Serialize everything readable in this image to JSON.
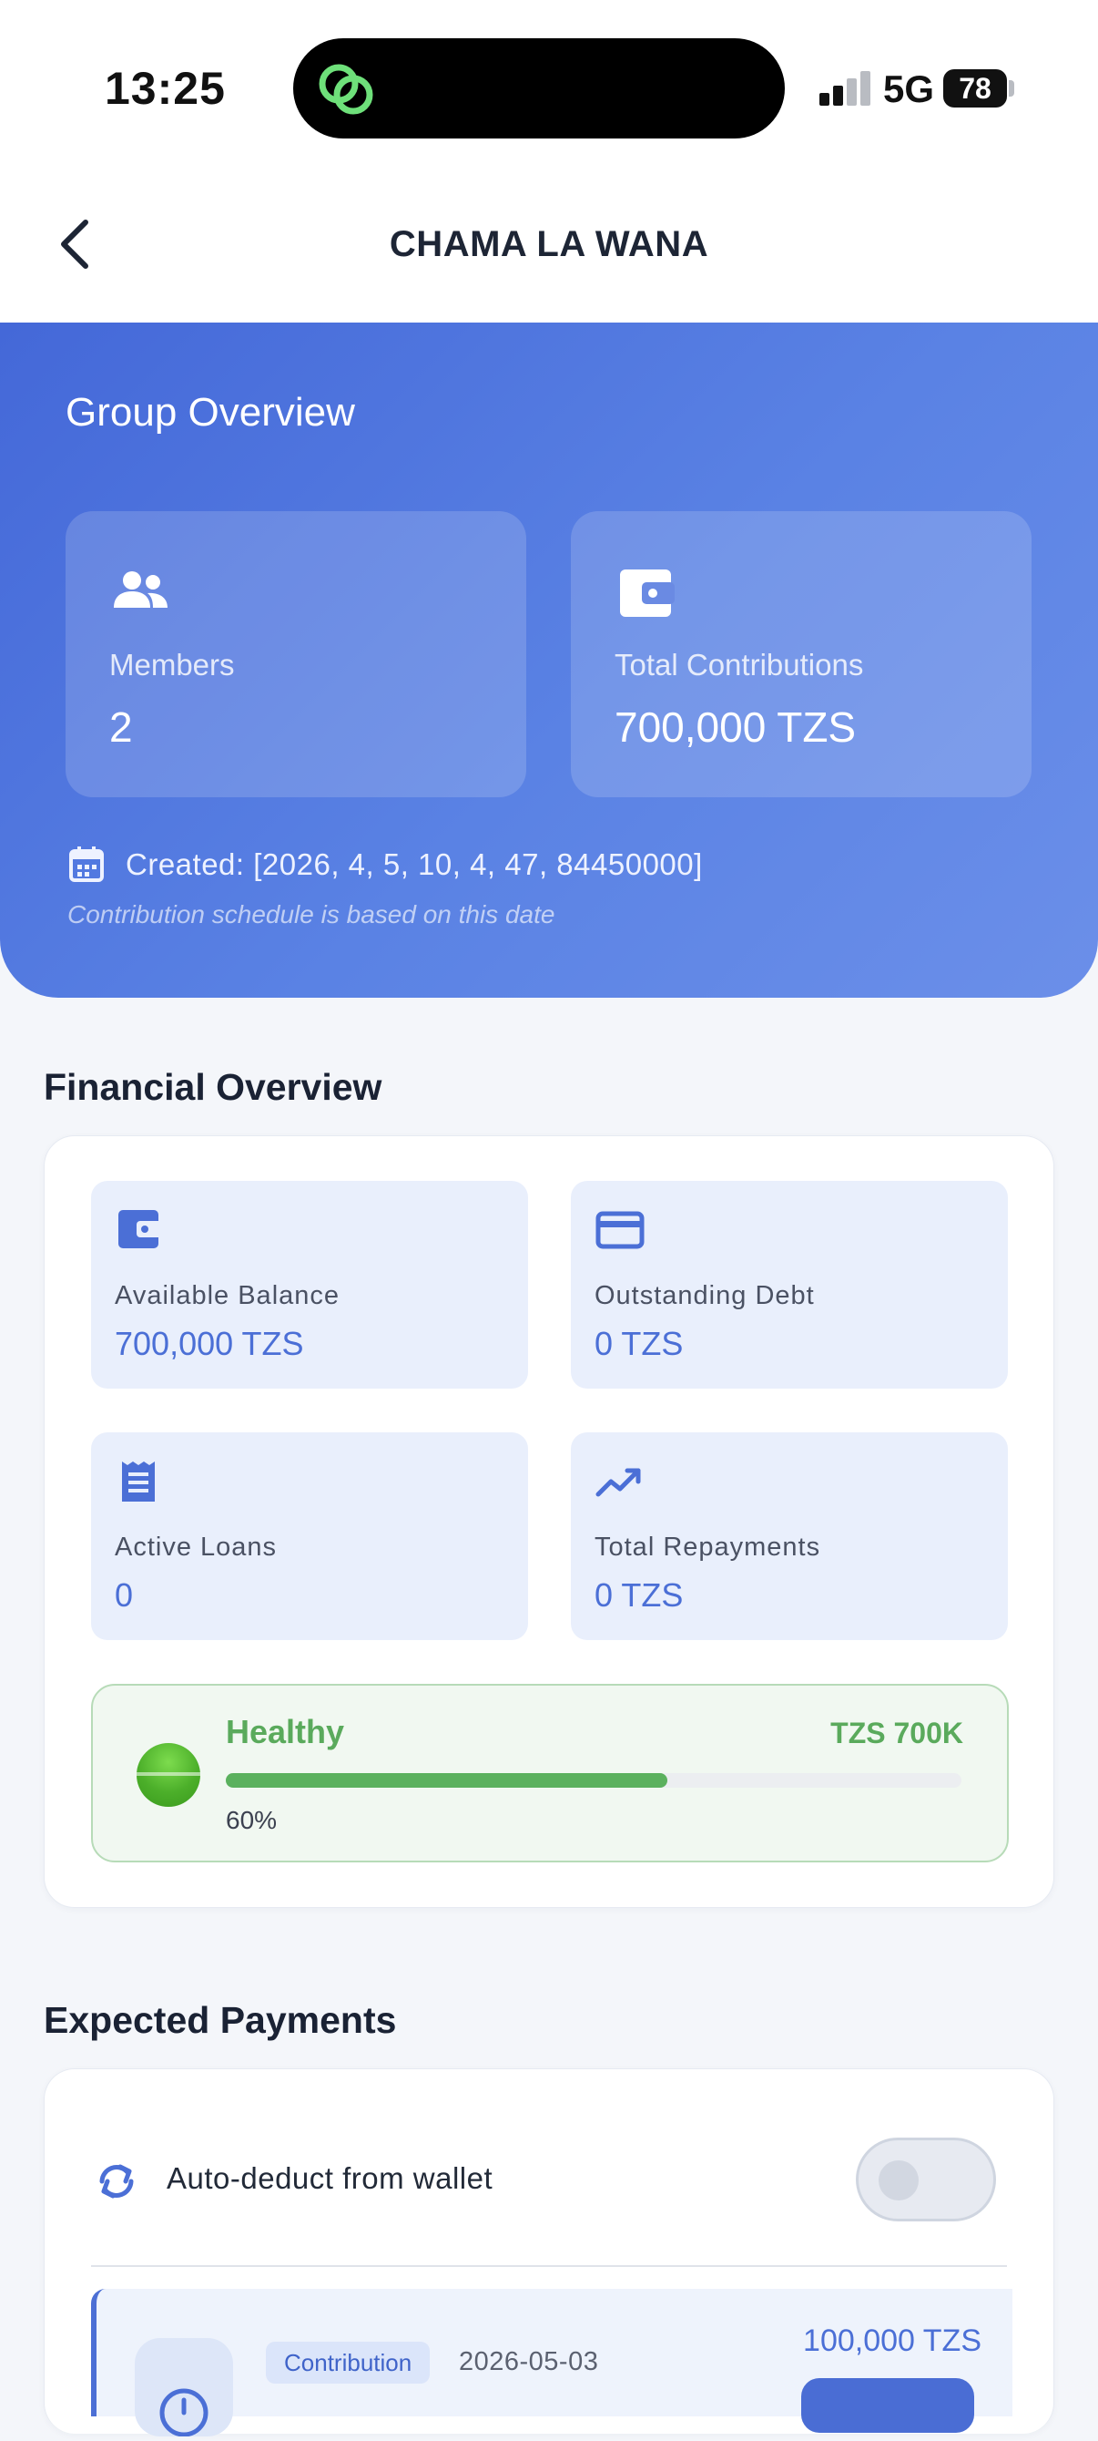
{
  "status_bar": {
    "time": "13:25",
    "network": "5G",
    "battery": "78"
  },
  "header": {
    "title": "CHAMA LA WANA"
  },
  "group_overview": {
    "title": "Group Overview",
    "members": {
      "label": "Members",
      "value": "2",
      "icon": "people-icon"
    },
    "total_contributions": {
      "label": "Total Contributions",
      "value": "700,000 TZS",
      "icon": "wallet-icon"
    },
    "created": "Created: [2026, 4, 5, 10, 4, 47, 84450000]",
    "created_note": "Contribution schedule is based on this date"
  },
  "financial_overview": {
    "title": "Financial Overview",
    "tiles": [
      {
        "label": "Available Balance",
        "value": "700,000 TZS",
        "icon": "wallet-icon"
      },
      {
        "label": "Outstanding Debt",
        "value": "0 TZS",
        "icon": "credit-card-icon"
      },
      {
        "label": "Active Loans",
        "value": "0",
        "icon": "receipt-icon"
      },
      {
        "label": "Total Repayments",
        "value": "0 TZS",
        "icon": "trending-up-icon"
      }
    ],
    "health": {
      "label": "Healthy",
      "amount": "TZS 700K",
      "percent_label": "60%",
      "percent": 60,
      "color": "#5bb15e"
    }
  },
  "expected_payments": {
    "title": "Expected Payments",
    "auto_deduct_label": "Auto-deduct from wallet",
    "auto_deduct_enabled": false,
    "items": [
      {
        "type": "Contribution",
        "date": "2026-05-03",
        "amount": "100,000 TZS"
      }
    ]
  },
  "colors": {
    "primary": "#4a6dd4",
    "healthy": "#5aaa5c",
    "background": "#f4f6fa"
  }
}
